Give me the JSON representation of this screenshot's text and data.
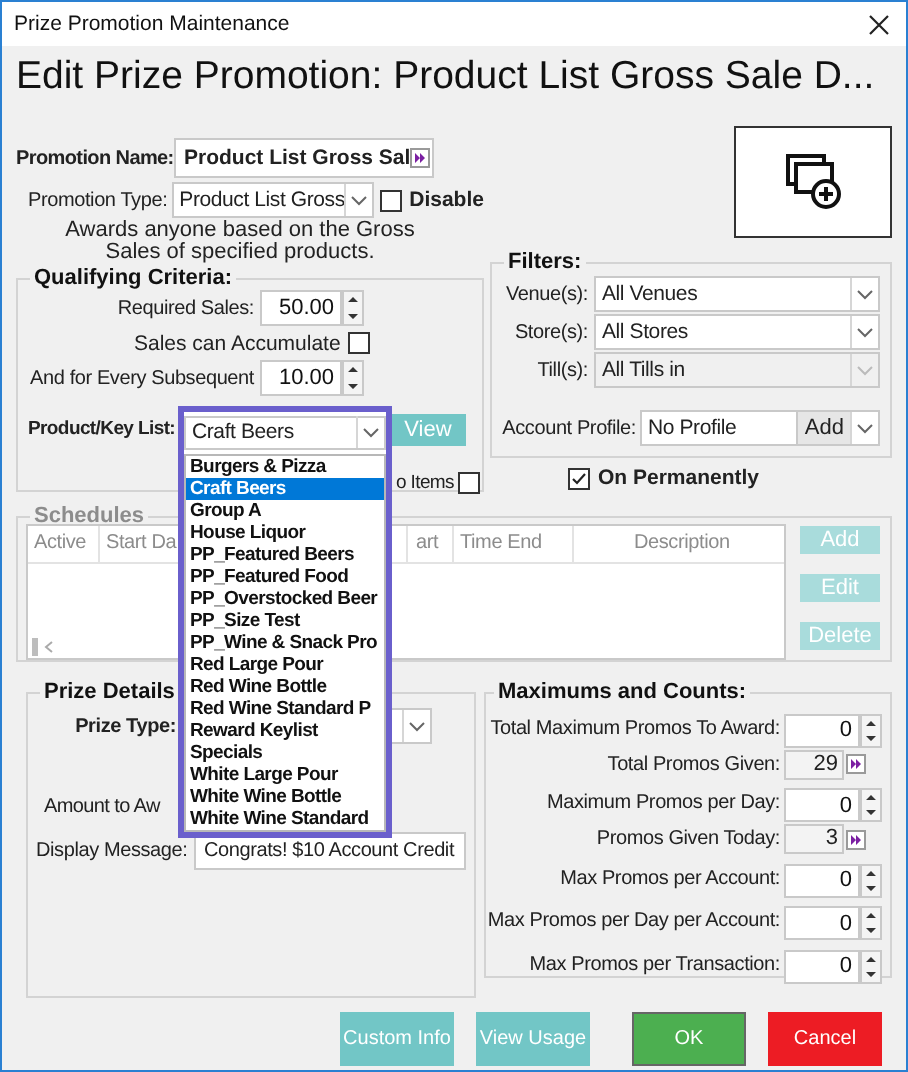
{
  "window": {
    "title": "Prize Promotion Maintenance"
  },
  "heading": "Edit Prize Promotion: Product List Gross Sale D...",
  "promotion_name": {
    "label": "Promotion Name:",
    "value": "Product List Gross Sal"
  },
  "promotion_type": {
    "label": "Promotion Type:",
    "value": "Product List Gross"
  },
  "disable": {
    "label": "Disable",
    "checked": false
  },
  "description": "Awards anyone based on the Gross Sales of specified products.",
  "qualifying_criteria": {
    "title": "Qualifying Criteria:",
    "required_sales": {
      "label": "Required Sales:",
      "value": "50.00"
    },
    "sales_can_accumulate": {
      "label": "Sales can Accumulate",
      "checked": false
    },
    "every_subsequent": {
      "label": "And for Every Subsequent",
      "value": "10.00"
    },
    "product_key_list": {
      "label": "Product/Key List:",
      "value": "Craft Beers",
      "expanded": true,
      "options": [
        {
          "label": "Burgers & Pizza",
          "selected": false
        },
        {
          "label": "Craft Beers",
          "selected": true
        },
        {
          "label": "Group A",
          "selected": false
        },
        {
          "label": "House Liquor",
          "selected": false
        },
        {
          "label": "PP_Featured Beers",
          "selected": false
        },
        {
          "label": "PP_Featured Food",
          "selected": false
        },
        {
          "label": "PP_Overstocked Beer",
          "selected": false
        },
        {
          "label": "PP_Size Test",
          "selected": false
        },
        {
          "label": "PP_Wine & Snack Pro",
          "selected": false
        },
        {
          "label": "Red Large Pour",
          "selected": false
        },
        {
          "label": "Red Wine Bottle",
          "selected": false
        },
        {
          "label": "Red Wine Standard P",
          "selected": false
        },
        {
          "label": "Reward Keylist",
          "selected": false
        },
        {
          "label": "Specials",
          "selected": false
        },
        {
          "label": "White Large Pour",
          "selected": false
        },
        {
          "label": "White Wine Bottle",
          "selected": false
        },
        {
          "label": "White Wine Standard",
          "selected": false
        }
      ]
    },
    "view_button": {
      "label": "View"
    },
    "items_option": {
      "label": "o Items",
      "checked": false
    }
  },
  "filters": {
    "title": "Filters:",
    "fields": [
      {
        "label": "Venue(s):",
        "value": "All Venues",
        "disabled": false
      },
      {
        "label": "Store(s):",
        "value": "All Stores",
        "disabled": false
      },
      {
        "label": "Till(s):",
        "value": "All Tills in",
        "disabled": true
      }
    ],
    "account_profile": {
      "label": "Account Profile:",
      "value": "No Profile",
      "button": "Add"
    }
  },
  "on_permanently": {
    "label": "On Permanently",
    "checked": true
  },
  "schedules": {
    "title": "Schedules",
    "disabled": true,
    "columns": [
      "Active",
      "Start Da",
      "art",
      "Time End",
      "Description"
    ],
    "buttons": [
      {
        "label": "Add",
        "disabled": true
      },
      {
        "label": "Edit",
        "disabled": true
      },
      {
        "label": "Delete",
        "disabled": true
      }
    ]
  },
  "prize_details": {
    "title": "Prize Details",
    "prize_type": {
      "label": "Prize Type:"
    },
    "amount": {
      "label": "Amount to Aw"
    },
    "display_message": {
      "label": "Display Message:",
      "value": "Congrats! $10 Account Credit"
    }
  },
  "maximums": {
    "title": "Maximums and Counts:",
    "rows": [
      {
        "kind": "spin",
        "label": "Total Maximum Promos To Award:",
        "value": "0"
      },
      {
        "kind": "link",
        "label": "Total Promos Given:",
        "value": "29"
      },
      {
        "kind": "spin",
        "label": "Maximum Promos per Day:",
        "value": "0"
      },
      {
        "kind": "link",
        "label": "Promos Given Today:",
        "value": "3"
      },
      {
        "kind": "spin",
        "label": "Max Promos per Account:",
        "value": "0"
      },
      {
        "kind": "spin",
        "label": "Max Promos per Day per Account:",
        "value": "0"
      },
      {
        "kind": "spin",
        "label": "Max Promos per Transaction:",
        "value": "0"
      }
    ]
  },
  "buttons": [
    {
      "kind": "info",
      "label": "Custom Info"
    },
    {
      "kind": "info",
      "label": "View Usage"
    },
    {
      "kind": "ok",
      "label": "OK"
    },
    {
      "kind": "cancel",
      "label": "Cancel"
    }
  ]
}
